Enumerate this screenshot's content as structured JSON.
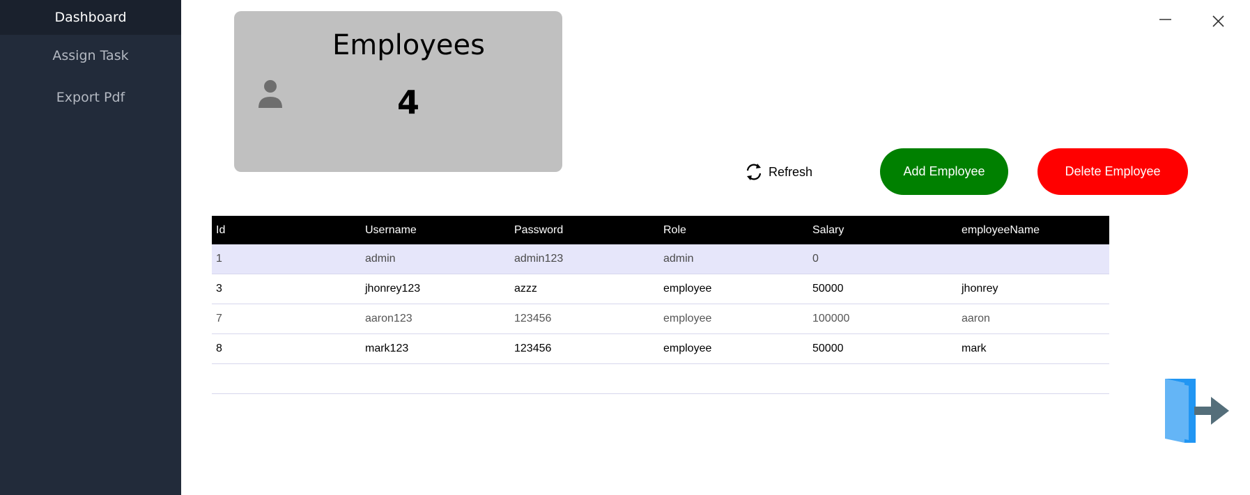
{
  "sidebar": {
    "items": [
      {
        "label": "Dashboard",
        "active": true
      },
      {
        "label": "Assign Task",
        "active": false
      },
      {
        "label": "Export Pdf",
        "active": false
      }
    ]
  },
  "window": {
    "minimize_icon": "minimize-icon",
    "close_icon": "close-icon"
  },
  "card": {
    "title": "Employees",
    "count": "4",
    "icon": "person-icon"
  },
  "toolbar": {
    "refresh_label": "Refresh",
    "refresh_icon": "refresh-icon",
    "add_label": "Add Employee",
    "delete_label": "Delete Employee"
  },
  "table": {
    "columns": [
      "Id",
      "Username",
      "Password",
      "Role",
      "Salary",
      "employeeName"
    ],
    "rows": [
      [
        "1",
        "admin",
        "admin123",
        "admin",
        "0",
        ""
      ],
      [
        "3",
        "jhonrey123",
        "azzz",
        "employee",
        "50000",
        "jhonrey"
      ],
      [
        "7",
        "aaron123",
        "123456",
        "employee",
        "100000",
        "aaron"
      ],
      [
        "8",
        "mark123",
        "123456",
        "employee",
        "50000",
        "mark"
      ]
    ]
  },
  "logout": {
    "icon": "logout-icon"
  },
  "colors": {
    "sidebar_bg": "#222b3a",
    "card_bg": "#c0c0c0",
    "add_button": "#008000",
    "delete_button": "#ff0000",
    "table_header": "#000000",
    "selected_row": "#e6e6fa"
  }
}
